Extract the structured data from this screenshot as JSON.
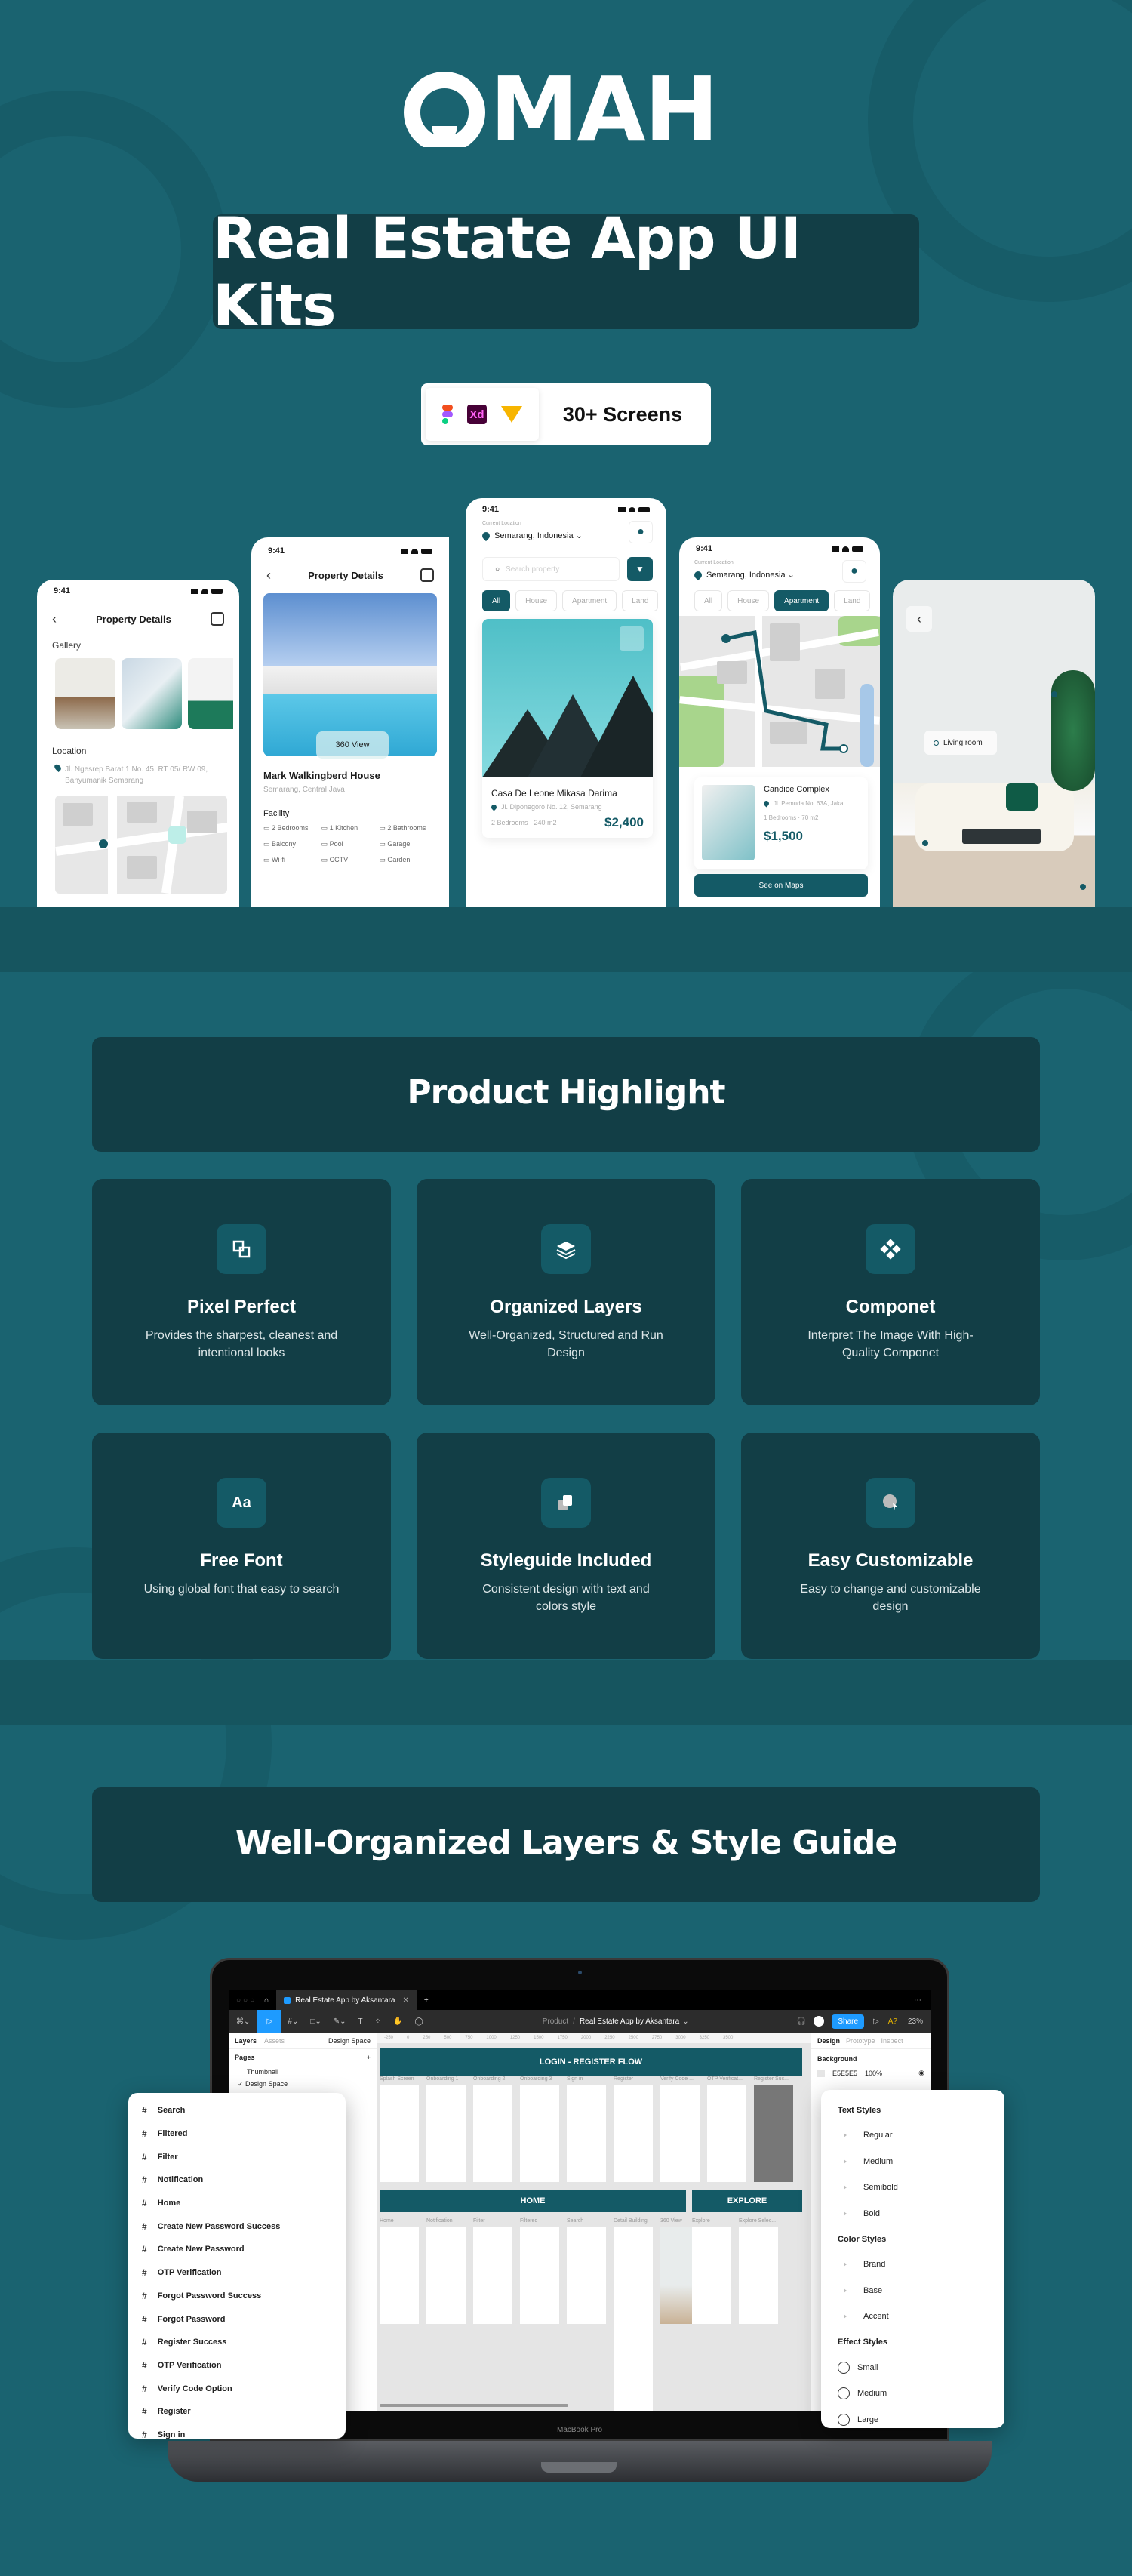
{
  "brand": {
    "logo_text": "MAH",
    "logo_o_icon": "omah-logo-o"
  },
  "hero": {
    "title": "Real Estate App UI Kits",
    "badge": {
      "tools": [
        "figma-icon",
        "xd-icon",
        "sketch-icon"
      ],
      "xd_label": "Xd",
      "screens_label": "30+ Screens"
    }
  },
  "colors": {
    "background": "#1A6370",
    "panel": "#123E46",
    "brand": "#145A66",
    "accent_share": "#1E9BFF"
  },
  "phones": {
    "status_time": "9:41",
    "gallery_detail": {
      "title": "Property Details",
      "gallery_label": "Gallery",
      "location_label": "Location",
      "address": "Jl. Ngesrep Barat 1 No. 45, RT 05/ RW 09, Banyumanik Semarang"
    },
    "property_detail": {
      "title": "Property Details",
      "view_label": "360 View",
      "name": "Mark Walkingberd House",
      "city": "Semarang, Central Java",
      "facility_label": "Facility",
      "facilities": [
        "2 Bedrooms",
        "1 Kitchen",
        "2 Bathrooms",
        "Balcony",
        "Pool",
        "Garage",
        "Wi-fi",
        "CCTV",
        "Garden"
      ]
    },
    "home": {
      "current_location_label": "Current Location",
      "location": "Semarang, Indonesia",
      "search_placeholder": "Search property",
      "chips": [
        "All",
        "House",
        "Apartment",
        "Land"
      ],
      "active_chip": "All",
      "card": {
        "name": "Casa De Leone Mikasa Darima",
        "address": "Jl. Diponegoro No. 12, Semarang",
        "bedrooms": "2 Bedrooms",
        "area": "240 m2",
        "price": "$2,400"
      }
    },
    "explore": {
      "current_location_label": "Current Location",
      "location": "Semarang, Indonesia",
      "chips": [
        "All",
        "House",
        "Apartment",
        "Land"
      ],
      "active_chip": "Apartment",
      "card": {
        "name": "Candice Complex",
        "address": "Jl. Pemuda No. 63A, Jaka...",
        "bedrooms": "1 Bedrooms",
        "area": "70 m2",
        "price": "$1,500"
      },
      "cta": "See on Maps"
    },
    "view360": {
      "tag": "Living room"
    }
  },
  "highlight": {
    "title": "Product Highlight",
    "cards": [
      {
        "icon": "pixel-perfect-icon",
        "title": "Pixel Perfect",
        "desc": "Provides the sharpest, cleanest and intentional looks"
      },
      {
        "icon": "layers-icon",
        "title": "Organized Layers",
        "desc": "Well-Organized, Structured and Run Design"
      },
      {
        "icon": "component-icon",
        "title": "Componet",
        "desc": "Interpret The Image With High-Quality Componet"
      },
      {
        "icon": "font-icon",
        "glyph": "Aa",
        "title": "Free Font",
        "desc": "Using global font that easy to search"
      },
      {
        "icon": "styleguide-icon",
        "title": "Styleguide Included",
        "desc": "Consistent design with text and colors style"
      },
      {
        "icon": "customize-icon",
        "title": "Easy Customizable",
        "desc": "Easy to change and customizable design"
      }
    ]
  },
  "layers_section": {
    "title": "Well-Organized Layers & Style Guide"
  },
  "figma": {
    "tab_title": "Real Estate App by Aksantara",
    "breadcrumb_project": "Product",
    "breadcrumb_file": "Real Estate App by Aksantara",
    "share_label": "Share",
    "zoom_level": "23%",
    "left_tabs": [
      "Layers",
      "Assets"
    ],
    "page_selector": "Design Space",
    "pages_label": "Pages",
    "pages": [
      "Thumbnail",
      "Design Space"
    ],
    "right_tabs": [
      "Design",
      "Prototype",
      "Inspect"
    ],
    "background_label": "Background",
    "background_hex": "E5E5E5",
    "background_opacity": "100%",
    "ruler": [
      "-250",
      "0",
      "250",
      "500",
      "750",
      "1000",
      "1250",
      "1500",
      "1750",
      "2000",
      "2250",
      "2500",
      "2750",
      "3000",
      "3250",
      "3500"
    ],
    "sections": [
      {
        "label": "LOGIN - REGISTER FLOW",
        "frames": [
          "Splash Screen",
          "Onboarding 1",
          "Onboarding 2",
          "Onboarding 3",
          "Sign in",
          "Register",
          "Verify Code ...",
          "OTP Verificat...",
          "Register Suc..."
        ]
      },
      {
        "label": "HOME",
        "frames": [
          "Home",
          "Notification",
          "Filter",
          "Filtered",
          "Search",
          "Detail Building",
          "360 View"
        ]
      },
      {
        "label": "EXPLORE",
        "frames": [
          "Explore",
          "Explore Selec..."
        ]
      }
    ],
    "device_label": "MacBook Pro"
  },
  "layers_list": [
    "Search",
    "Filtered",
    "Filter",
    "Notification",
    "Home",
    "Create New Password Success",
    "Create New Password",
    "OTP Verification",
    "Forgot Password Success",
    "Forgot Password",
    "Register Success",
    "OTP Verification",
    "Verify Code Option",
    "Register",
    "Sign in"
  ],
  "styles_panel": {
    "text_styles_label": "Text Styles",
    "text_styles": [
      "Regular",
      "Medium",
      "Semibold",
      "Bold"
    ],
    "color_styles_label": "Color Styles",
    "color_styles": [
      "Brand",
      "Base",
      "Accent"
    ],
    "effect_styles_label": "Effect Styles",
    "effect_styles": [
      "Small",
      "Medium",
      "Large"
    ]
  }
}
